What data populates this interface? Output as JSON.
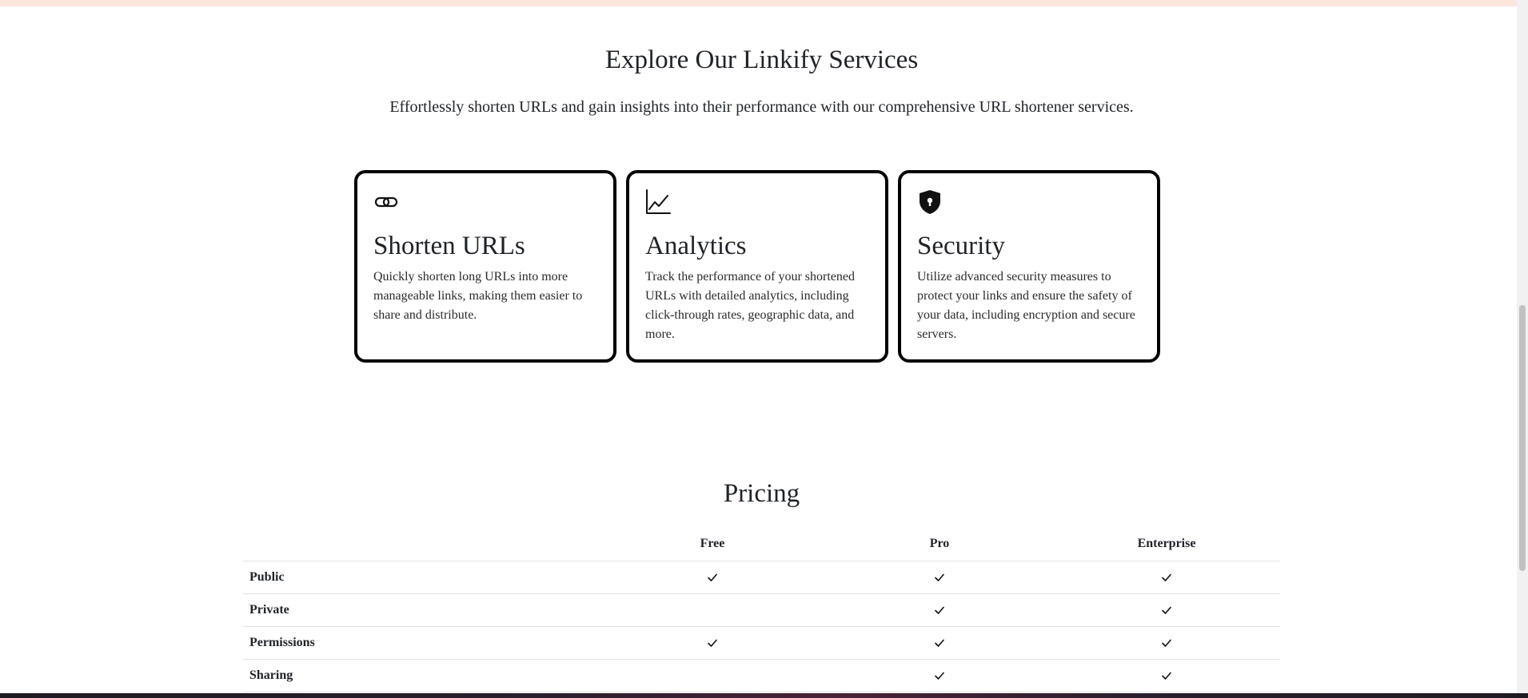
{
  "services": {
    "title": "Explore Our Linkify Services",
    "subtitle": "Effortlessly shorten URLs and gain insights into their performance with our comprehensive URL shortener services.",
    "cards": [
      {
        "icon": "link-icon",
        "title": "Shorten URLs",
        "description": "Quickly shorten long URLs into more manageable links, making them easier to share and distribute."
      },
      {
        "icon": "analytics-chart-icon",
        "title": "Analytics",
        "description": "Track the performance of your shortened URLs with detailed analytics, including click-through rates, geographic data, and more."
      },
      {
        "icon": "shield-lock-icon",
        "title": "Security",
        "description": "Utilize advanced security measures to protect your links and ensure the safety of your data, including encryption and secure servers."
      }
    ]
  },
  "pricing": {
    "title": "Pricing",
    "plans": [
      "Free",
      "Pro",
      "Enterprise"
    ],
    "features": [
      {
        "name": "Public",
        "included": [
          true,
          true,
          true
        ]
      },
      {
        "name": "Private",
        "included": [
          false,
          true,
          true
        ]
      },
      {
        "name": "Permissions",
        "included": [
          true,
          true,
          true
        ]
      },
      {
        "name": "Sharing",
        "included": [
          false,
          true,
          true
        ]
      }
    ]
  },
  "colors": {
    "top_strip": "#fbe6dd",
    "card_border": "#000000",
    "text": "#1f2328"
  }
}
